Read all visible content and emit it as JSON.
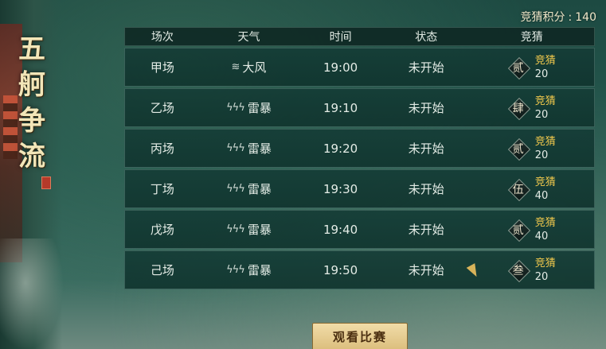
{
  "title_chars": [
    "五",
    "舸",
    "争",
    "流"
  ],
  "points": {
    "label": "竞猜积分",
    "separator": ":",
    "value": "140"
  },
  "headers": {
    "match": "场次",
    "weather": "天气",
    "time": "时间",
    "status": "状态",
    "bet": "竞猜"
  },
  "rows": [
    {
      "match": "甲场",
      "weather_icon": "wind-icon",
      "weather": "大风",
      "time": "19:00",
      "status": "未开始",
      "badge": "贰",
      "bet_label": "竞猜",
      "bet_value": "20"
    },
    {
      "match": "乙场",
      "weather_icon": "thunderstorm-icon",
      "weather": "雷暴",
      "time": "19:10",
      "status": "未开始",
      "badge": "肆",
      "bet_label": "竞猜",
      "bet_value": "20"
    },
    {
      "match": "丙场",
      "weather_icon": "thunderstorm-icon",
      "weather": "雷暴",
      "time": "19:20",
      "status": "未开始",
      "badge": "贰",
      "bet_label": "竞猜",
      "bet_value": "20"
    },
    {
      "match": "丁场",
      "weather_icon": "thunderstorm-icon",
      "weather": "雷暴",
      "time": "19:30",
      "status": "未开始",
      "badge": "伍",
      "bet_label": "竞猜",
      "bet_value": "40"
    },
    {
      "match": "戊场",
      "weather_icon": "thunderstorm-icon",
      "weather": "雷暴",
      "time": "19:40",
      "status": "未开始",
      "badge": "贰",
      "bet_label": "竞猜",
      "bet_value": "40"
    },
    {
      "match": "己场",
      "weather_icon": "thunderstorm-icon",
      "weather": "雷暴",
      "time": "19:50",
      "status": "未开始",
      "badge": "叁",
      "bet_label": "竞猜",
      "bet_value": "20"
    }
  ],
  "watch_button": "观看比赛",
  "colors": {
    "accent_gold": "#f2c94c",
    "button_bg": "#e8cf92",
    "table_bg": "#12342e"
  }
}
